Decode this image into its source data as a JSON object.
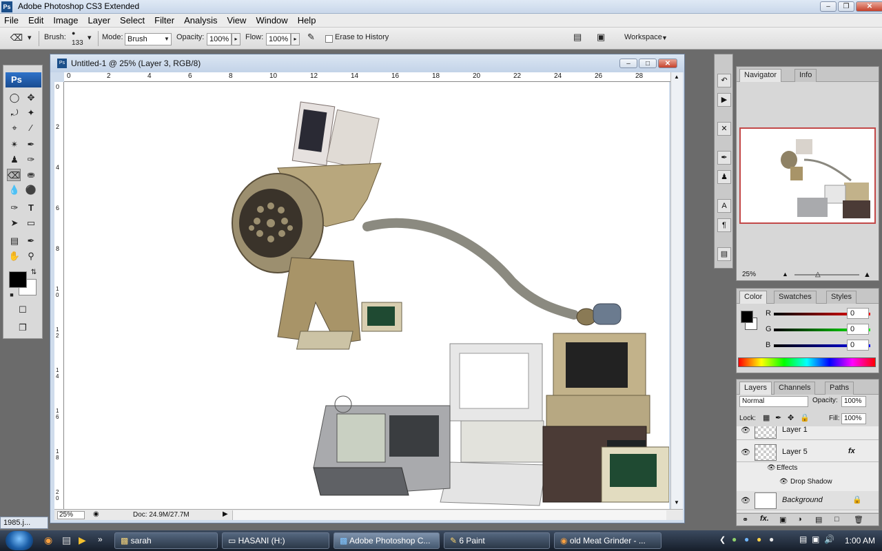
{
  "app": {
    "title": "Adobe Photoshop CS3 Extended",
    "logo": "Ps"
  },
  "menu": [
    "File",
    "Edit",
    "Image",
    "Layer",
    "Select",
    "Filter",
    "Analysis",
    "View",
    "Window",
    "Help"
  ],
  "options": {
    "brush_label": "Brush:",
    "brush_size": "133",
    "mode_label": "Mode:",
    "mode_value": "Brush",
    "opacity_label": "Opacity:",
    "opacity_value": "100%",
    "flow_label": "Flow:",
    "flow_value": "100%",
    "erase_history_label": "Erase to History",
    "workspace_label": "Workspace"
  },
  "document": {
    "title": "Untitled-1 @ 25% (Layer 3, RGB/8)",
    "zoom": "25%",
    "doc_info": "Doc: 24.9M/27.7M",
    "hruler_ticks": [
      "0",
      "2",
      "4",
      "6",
      "8",
      "10",
      "12",
      "14",
      "16",
      "18",
      "20",
      "22",
      "24",
      "26",
      "28"
    ],
    "vruler_ticks": [
      "0",
      "2",
      "4",
      "6",
      "8",
      "1 0",
      "1 2",
      "1 4",
      "1 6",
      "1 8",
      "2 0"
    ]
  },
  "navigator": {
    "tabs": [
      "Navigator",
      "Info"
    ],
    "zoom": "25%"
  },
  "color": {
    "tabs": [
      "Color",
      "Swatches",
      "Styles"
    ],
    "r_label": "R",
    "g_label": "G",
    "b_label": "B",
    "r": "0",
    "g": "0",
    "b": "0"
  },
  "layers": {
    "tabs": [
      "Layers",
      "Channels",
      "Paths"
    ],
    "blend_mode": "Normal",
    "opacity_label": "Opacity:",
    "opacity": "100%",
    "lock_label": "Lock:",
    "fill_label": "Fill:",
    "fill": "100%",
    "rows": [
      {
        "name": "Layer 1"
      },
      {
        "name": "Layer 5",
        "fx": "fx"
      },
      {
        "name": "Effects"
      },
      {
        "name": "Drop Shadow"
      },
      {
        "name": "Background"
      }
    ]
  },
  "taskbar": {
    "items": [
      "sarah",
      "HASANI (H:)",
      "Adobe Photoshop C...",
      "6 Paint",
      "old Meat Grinder - ..."
    ],
    "clock": "1:00 AM",
    "mini_doc": "1985.j..."
  }
}
